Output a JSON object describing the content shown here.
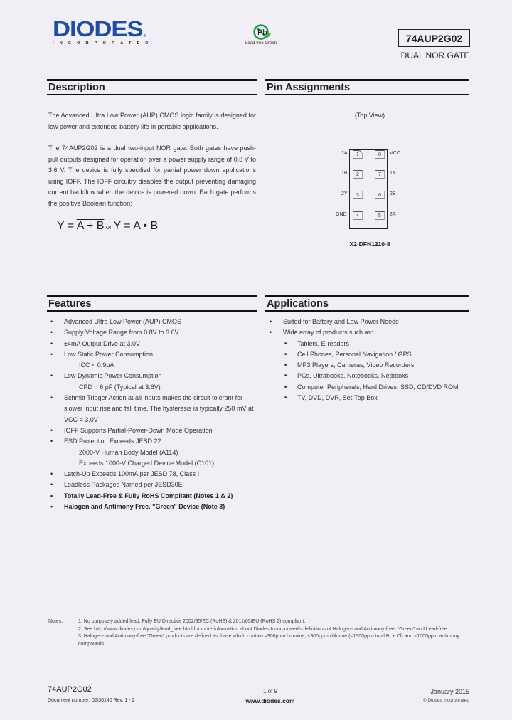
{
  "header": {
    "logo_text": "DIODES",
    "logo_subtext": "INCORPORATED",
    "logo_mark": "®",
    "badge_symbol": "Pb",
    "badge_label": "Lead-free Green",
    "part_number": "74AUP2G02",
    "part_description": "DUAL NOR GATE",
    "colors": {
      "brand": "#1f4e9a",
      "badge_green": "#1a9a3a"
    }
  },
  "description": {
    "title": "Description",
    "paragraph1": "The Advanced Ultra Low Power (AUP) CMOS logic family is designed for low power and extended battery life in portable applications.",
    "paragraph2": "The 74AUP2G02 is a dual two-input NOR gate. Both gates have push-pull outputs designed for operation over a power supply range of 0.8 V to 3.6 V. The device is fully specified for partial power down applications using IOFF. The IOFF circuitry disables the output preventing damaging current backflow when the device is powered down. Each gate performs the positive Boolean function:",
    "equation": {
      "lhs1": "Y = ",
      "rhs1": "A + B",
      "or": " or ",
      "lhs2": "Y = ",
      "rhs2": "A • B"
    }
  },
  "pin_assignments": {
    "title": "Pin Assignments",
    "view_label": "(Top View)",
    "package_label": "X2-DFN1210-8",
    "left_pins": [
      {
        "number": "1",
        "name": "1A"
      },
      {
        "number": "2",
        "name": "1B"
      },
      {
        "number": "3",
        "name": "2Y"
      },
      {
        "number": "4",
        "name": "GND"
      }
    ],
    "right_pins": [
      {
        "number": "8",
        "name": "VCC"
      },
      {
        "number": "7",
        "name": "1Y"
      },
      {
        "number": "6",
        "name": "2B"
      },
      {
        "number": "5",
        "name": "2A"
      }
    ]
  },
  "features": {
    "title": "Features",
    "items": [
      {
        "text": "Advanced Ultra Low Power (AUP) CMOS",
        "type": "bullet"
      },
      {
        "text": "Supply Voltage Range from 0.8V to 3.6V",
        "type": "bullet"
      },
      {
        "text": "±4mA Output Drive at 3.0V",
        "type": "bullet"
      },
      {
        "text": "Low Static Power Consumption",
        "type": "bullet"
      },
      {
        "text": "ICC < 0.9μA",
        "type": "sub"
      },
      {
        "text": "Low Dynamic Power Consumption",
        "type": "bullet"
      },
      {
        "text": "CPD = 6 pF (Typical at 3.6V)",
        "type": "sub"
      },
      {
        "text": "Schmitt Trigger Action at all inputs makes the circuit tolerant for slower input rise and fall time. The hysteresis is typically 250 mV at VCC = 3.0V",
        "type": "bullet"
      },
      {
        "text": "IOFF Supports Partial-Power-Down Mode Operation",
        "type": "bullet"
      },
      {
        "text": "ESD Protection Exceeds JESD 22",
        "type": "bullet"
      },
      {
        "text": "2000-V Human Body Model (A114)",
        "type": "sub"
      },
      {
        "text": "Exceeds 1000-V Charged Device Model (C101)",
        "type": "sub"
      },
      {
        "text": "Latch-Up Exceeds 100mA per JESD 78, Class I",
        "type": "bullet"
      },
      {
        "text": "Leadless Packages Named per JESD30E",
        "type": "bullet"
      },
      {
        "text": "Totally Lead-Free & Fully RoHS Compliant (Notes 1 & 2)",
        "type": "bold"
      },
      {
        "text": "Halogen and Antimony Free. \"Green\" Device (Note 3)",
        "type": "bold"
      }
    ]
  },
  "applications": {
    "title": "Applications",
    "items": [
      {
        "text": "Suited for Battery and Low Power Needs",
        "type": "bullet"
      },
      {
        "text": "Wide array of products such as:",
        "type": "bullet"
      },
      {
        "text": "Tablets, E-readers",
        "type": "square"
      },
      {
        "text": "Cell Phones, Personal Navigation / GPS",
        "type": "square"
      },
      {
        "text": "MP3 Players, Cameras, Video Recorders",
        "type": "square"
      },
      {
        "text": "PCs, Ultrabooks, Notebooks, Netbooks",
        "type": "square"
      },
      {
        "text": "Computer Peripherals, Hard Drives, SSD, CD/DVD ROM",
        "type": "square"
      },
      {
        "text": "TV, DVD, DVR, Set-Top Box",
        "type": "square"
      }
    ]
  },
  "notes": {
    "label": "Notes:",
    "items": [
      "1. No purposely added lead. Fully EU Directive 2002/95/EC (RoHS) & 2011/65/EU (RoHS 2) compliant.",
      "2. See http://www.diodes.com/quality/lead_free.html for more information about Diodes Incorporated's definitions of Halogen- and Antimony-free, \"Green\" and Lead-free.",
      "3. Halogen- and Antimony-free \"Green\" products are defined as those which contain <900ppm bromine, <900ppm chlorine (<1500ppm total Br + Cl) and <1000ppm antimony compounds."
    ]
  },
  "footer": {
    "part_number": "74AUP2G02",
    "document_number": "Document number: DS36140 Rev. 1 - 2",
    "page": "1 of 9",
    "website": "www.diodes.com",
    "date": "January 2015",
    "copyright": "© Diodes Incorporated"
  }
}
